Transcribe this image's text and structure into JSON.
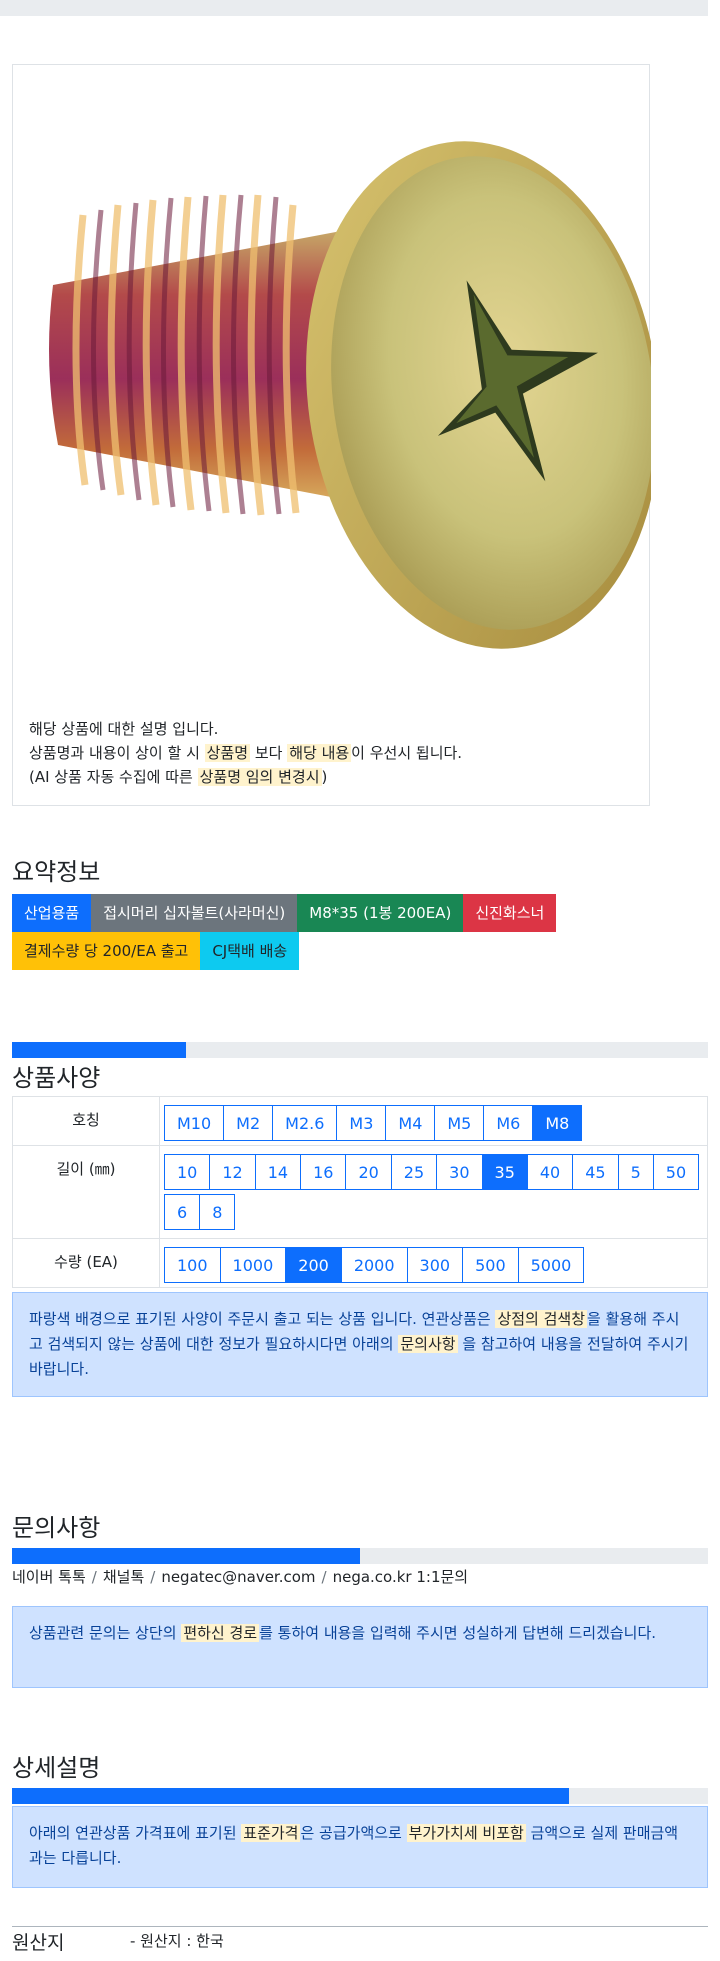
{
  "product": {
    "image_name": "countersunk-phillips-bolt-photo",
    "desc_line1": "해당 상품에 대한 설명 입니다.",
    "desc_line2_a": "상품명과 내용이 상이 할 시 ",
    "desc_line2_hl1": "상품명",
    "desc_line2_b": " 보다 ",
    "desc_line2_hl2": "해당 내용",
    "desc_line2_c": "이 우선시 됩니다.",
    "desc_line3_a": "(AI 상품 자동 수집에 따른 ",
    "desc_line3_hl": "상품명 임의 변경시",
    "desc_line3_b": ")"
  },
  "summary": {
    "title": "요약정보",
    "badges": [
      "산업용품",
      "접시머리 십자볼트(사라머신)",
      "M8*35 (1봉 200EA)",
      "신진화스너",
      "결제수량 당 200/EA 출고",
      "CJ택배 배송"
    ]
  },
  "spec": {
    "title": "상품사양",
    "progress_pct": 25,
    "rows": [
      {
        "label": "호칭",
        "options": [
          "M10",
          "M2",
          "M2.6",
          "M3",
          "M4",
          "M5",
          "M6",
          "M8"
        ],
        "selected": "M8"
      },
      {
        "label": "길이 (㎜)",
        "options": [
          "10",
          "12",
          "14",
          "16",
          "20",
          "25",
          "30",
          "35",
          "40",
          "45",
          "5",
          "50",
          "6",
          "8"
        ],
        "selected": "35"
      },
      {
        "label": "수량 (EA)",
        "options": [
          "100",
          "1000",
          "200",
          "2000",
          "300",
          "500",
          "5000"
        ],
        "selected": "200"
      }
    ],
    "notice_a": "파랑색 배경으로 표기된 사양이 주문시 출고 되는 상품 입니다. 연관상품은 ",
    "notice_hl1": "상점의 검색창",
    "notice_b": "을 활용해 주시고 검색되지 않는 상품에 대한 정보가 필요하시다면 아래의 ",
    "notice_hl2": "문의사항",
    "notice_c": " 을 참고하여 내용을 전달하여 주시기 바랍니다."
  },
  "inquiry": {
    "title": "문의사항",
    "progress_pct": 50,
    "channels": [
      "네이버 톡톡",
      "채널톡",
      "negatec@naver.com",
      "nega.co.kr 1:1문의"
    ],
    "notice_a": "상품관련 문의는 상단의 ",
    "notice_hl": "편하신 경로",
    "notice_b": "를 통하여 내용을 입력해 주시면 성실하게 답변해 드리겠습니다."
  },
  "detail": {
    "title": "상세설명",
    "progress_pct": 80,
    "notice_a": "아래의 연관상품 가격표에 표기된 ",
    "notice_hl1": "표준가격",
    "notice_b": "은 공급가액으로 ",
    "notice_hl2": "부가가치세 비포함",
    "notice_c": " 금액으로 실제 판매금액과는 다릅니다."
  },
  "origin": {
    "label": "원산지",
    "value": "- 원산지 : 한국"
  },
  "colors": {
    "primary": "#0d6efd",
    "alert_bg": "#cfe2ff",
    "highlight": "#fff3cd"
  }
}
